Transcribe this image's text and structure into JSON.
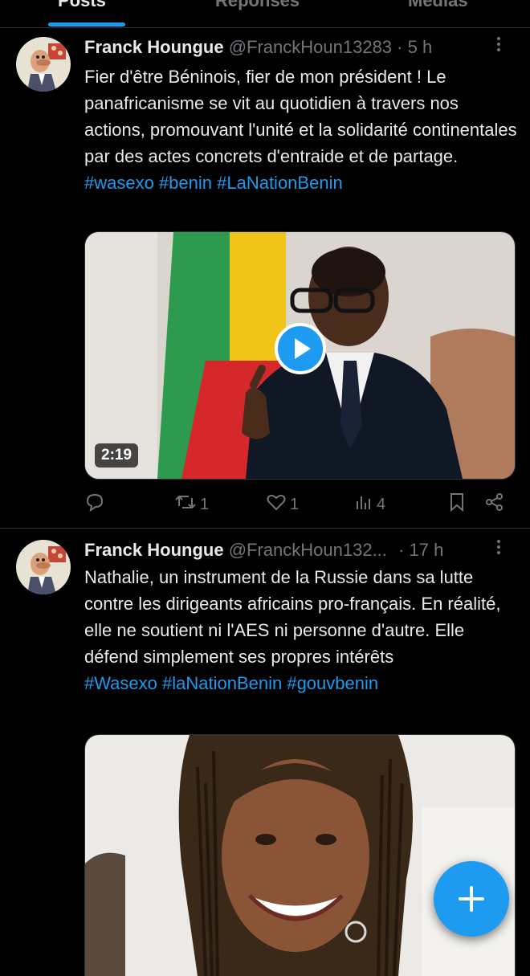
{
  "tabs": [
    "Posts",
    "Réponses",
    "Médias"
  ],
  "tweets": [
    {
      "name": "Franck Houngue",
      "handle": "@FranckHoun13283",
      "separator": "·",
      "time": "5 h",
      "text": "Fier d'être Béninois, fier de mon président ! Le panafricanisme se vit au quotidien à travers nos actions, promouvant l'unité et la solidarité continentales par des actes concrets d'entraide et de partage.",
      "hashtags": "#wasexo #benin #LaNationBenin",
      "video_duration": "2:19",
      "replies": "",
      "reposts": "1",
      "likes": "1",
      "views": "4"
    },
    {
      "name": "Franck Houngue",
      "handle": "@FranckHoun132...",
      "separator": "·",
      "time": "17 h",
      "text": "Nathalie, un instrument de la Russie dans sa lutte contre les dirigeants africains pro-français. En réalité, elle ne soutient ni l'AES ni personne d'autre. Elle défend simplement ses propres intérêts",
      "hashtags": "#Wasexo #laNationBenin #gouvbenin"
    }
  ],
  "colors": {
    "accent": "#1d9bf0",
    "background": "#000000",
    "muted": "#71767b",
    "text": "#e7e9ea"
  },
  "icons": [
    "more-icon",
    "reply-icon",
    "repost-icon",
    "like-icon",
    "views-icon",
    "bookmark-icon",
    "share-icon",
    "play-icon",
    "compose-plus-icon"
  ]
}
